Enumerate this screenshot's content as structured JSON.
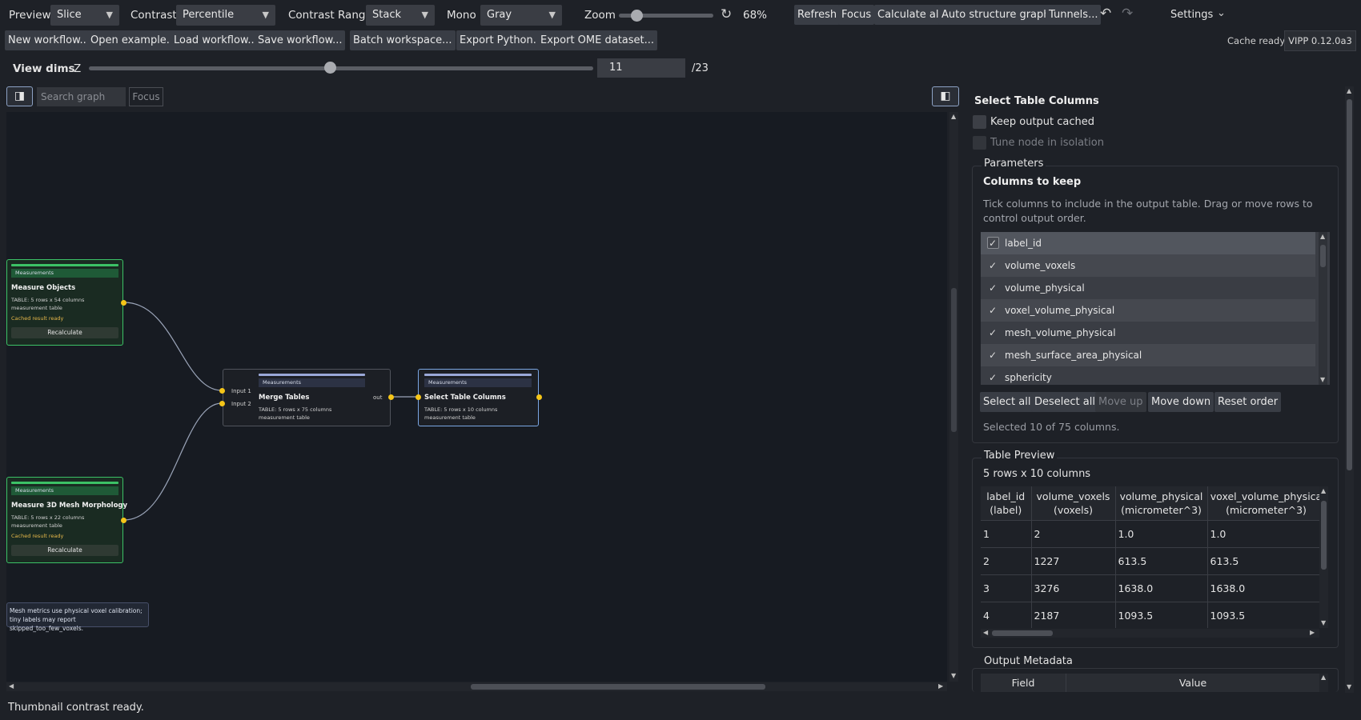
{
  "toolbar": {
    "preview_label": "Preview",
    "preview_value": "Slice",
    "contrast_label": "Contrast",
    "contrast_value": "Percentile",
    "contrast_range_label": "Contrast Range",
    "contrast_range_value": "Stack",
    "mono_label": "Mono",
    "mono_value": "Gray",
    "zoom_label": "Zoom",
    "zoom_value": "68%",
    "refresh": "Refresh",
    "focus": "Focus",
    "calculate_all": "Calculate all",
    "auto_structure_graph": "Auto structure graph",
    "tunnels": "Tunnels...",
    "settings": "Settings"
  },
  "workflow_bar": {
    "new_workflow": "New workflow...",
    "open_example": "Open example...",
    "load_workflow": "Load workflow...",
    "save_workflow": "Save workflow...",
    "batch_workspace": "Batch workspace...",
    "export_python": "Export Python...",
    "export_ome": "Export OME dataset...",
    "cache_status": "Cache ready",
    "version": "VIPP 0.12.0a3"
  },
  "view_dims": {
    "label": "View dims",
    "axis": "Z",
    "value": "11",
    "max": "/23",
    "fraction": 0.478
  },
  "graph": {
    "search_placeholder": "Search graph",
    "focus": "Focus",
    "nodes": [
      {
        "tag": "Measurements",
        "title": "Measure Objects",
        "info1": "TABLE: 5 rows x 54 columns",
        "info2": "measurement table",
        "cache": "Cached result ready",
        "button": "Recalculate"
      },
      {
        "tag": "Measurements",
        "title": "Merge Tables",
        "info1": "TABLE: 5 rows x 75 columns",
        "info2": "measurement table",
        "in1": "Input 1",
        "in2": "Input 2",
        "out": "out"
      },
      {
        "tag": "Measurements",
        "title": "Select Table Columns",
        "info1": "TABLE: 5 rows x 10 columns",
        "info2": "measurement table"
      },
      {
        "tag": "Measurements",
        "title": "Measure 3D Mesh Morphology",
        "info1": "TABLE: 5 rows x 22 columns",
        "info2": "measurement table",
        "cache": "Cached result ready",
        "button": "Recalculate"
      }
    ],
    "note": "Mesh metrics use physical voxel calibration; tiny labels may report skipped_too_few_voxels."
  },
  "panel": {
    "title": "Select Table Columns",
    "keep_cached": "Keep output cached",
    "tune_isolation": "Tune node in isolation",
    "parameters": "Parameters",
    "columns_heading": "Columns to keep",
    "columns_help": "Tick columns to include in the output table. Drag or move rows to control output order.",
    "columns": [
      {
        "name": "label_id",
        "checked": true
      },
      {
        "name": "volume_voxels",
        "checked": true
      },
      {
        "name": "volume_physical",
        "checked": true
      },
      {
        "name": "voxel_volume_physical",
        "checked": true
      },
      {
        "name": "mesh_volume_physical",
        "checked": true
      },
      {
        "name": "mesh_surface_area_physical",
        "checked": true
      },
      {
        "name": "sphericity",
        "checked": true
      }
    ],
    "select_all": "Select all",
    "deselect_all": "Deselect all",
    "move_up": "Move up",
    "move_down": "Move down",
    "reset_order": "Reset order",
    "selected_summary": "Selected 10 of 75 columns.",
    "table_preview": "Table Preview",
    "table_size": "5 rows x 10 columns",
    "table_headers": [
      [
        "label_id",
        "(label)"
      ],
      [
        "volume_voxels",
        "(voxels)"
      ],
      [
        "volume_physical",
        "(micrometer^3)"
      ],
      [
        "voxel_volume_physica",
        "(micrometer^3)"
      ]
    ],
    "table_rows": [
      [
        "1",
        "2",
        "1.0",
        "1.0"
      ],
      [
        "2",
        "1227",
        "613.5",
        "613.5"
      ],
      [
        "3",
        "3276",
        "1638.0",
        "1638.0"
      ],
      [
        "4",
        "2187",
        "1093.5",
        "1093.5"
      ]
    ],
    "output_metadata": "Output Metadata",
    "meta_field": "Field",
    "meta_value": "Value"
  },
  "status": "Thumbnail contrast ready."
}
